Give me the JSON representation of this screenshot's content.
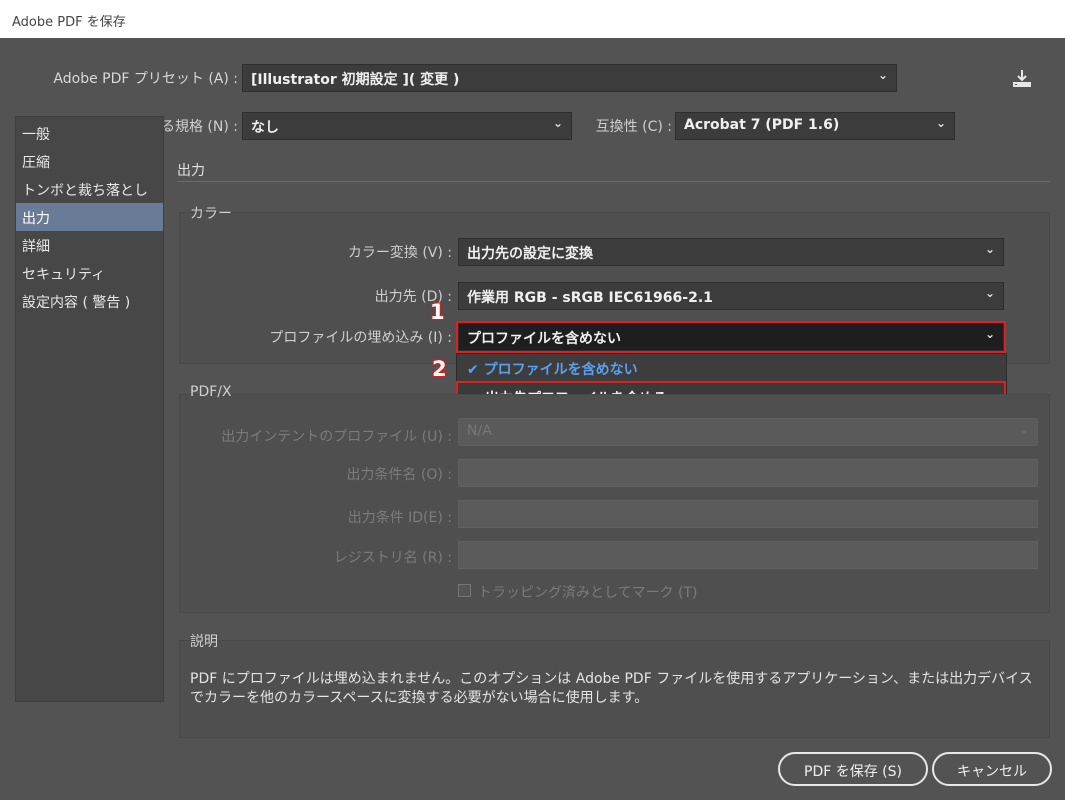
{
  "window": {
    "title": "Adobe PDF を保存"
  },
  "preset": {
    "label": "Adobe PDF プリセット (A) :",
    "value": "[Illustrator 初期設定 ]( 変更 )"
  },
  "standard": {
    "label": "準拠する規格 (N) :",
    "value": "なし"
  },
  "compat": {
    "label": "互換性 (C) :",
    "value": "Acrobat 7 (PDF 1.6)"
  },
  "sidebar": {
    "items": [
      {
        "label": "一般"
      },
      {
        "label": "圧縮"
      },
      {
        "label": "トンボと裁ち落とし"
      },
      {
        "label": "出力"
      },
      {
        "label": "詳細"
      },
      {
        "label": "セキュリティ"
      },
      {
        "label": "設定内容 ( 警告 )"
      }
    ]
  },
  "section": {
    "title": "出力"
  },
  "color_group": {
    "title": "カラー",
    "conversion": {
      "label": "カラー変換 (V) :",
      "value": "出力先の設定に変換"
    },
    "destination": {
      "label": "出力先 (D) :",
      "value": "作業用 RGB - sRGB IEC61966-2.1"
    },
    "profile": {
      "label": "プロファイルの埋め込み (I) :",
      "value": "プロファイルを含めない"
    }
  },
  "dropdown": {
    "options": [
      {
        "label": "プロファイルを含めない",
        "checked": true
      },
      {
        "label": "出力先プロファイルを含める",
        "checked": false
      }
    ]
  },
  "annotations": {
    "step1": "1",
    "step2": "2"
  },
  "pdfx": {
    "title": "PDF/X",
    "intent": {
      "label": "出力インテントのプロファイル (U) :",
      "value": "N/A"
    },
    "condition_name": {
      "label": "出力条件名 (O) :"
    },
    "condition_id": {
      "label": "出力条件 ID(E) :"
    },
    "registry": {
      "label": "レジストリ名 (R) :"
    },
    "trapped": {
      "label": "トラッピング済みとしてマーク (T)"
    }
  },
  "description": {
    "title": "説明",
    "text": "PDF にプロファイルは埋め込まれません。このオプションは Adobe PDF ファイルを使用するアプリケーション、または出力デバイスでカラーを他のカラースペースに変換する必要がない場合に使用します。"
  },
  "buttons": {
    "save": "PDF を保存 (S)",
    "cancel": "キャンセル"
  },
  "colors": {
    "dialog_bg": "#535353",
    "active_item": "#697b97",
    "highlight": "#e02020",
    "checked_option": "#5aa0f0"
  }
}
